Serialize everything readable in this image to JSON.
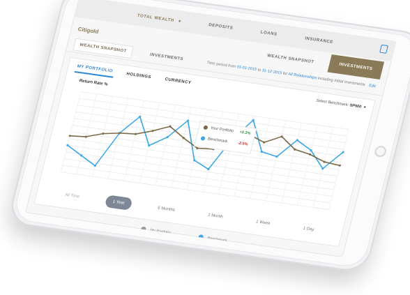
{
  "nav": {
    "total_wealth": "TOTAL WEALTH",
    "top_items": [
      "DEPOSITS",
      "LOANS",
      "INSURANCE"
    ]
  },
  "brand": "Citigold",
  "tabs": [
    "WEALTH SNAPSHOT",
    "INVESTMENTS"
  ],
  "subtabs": [
    "WEALTH SNAPSHOT",
    "INVESTMENTS"
  ],
  "period": {
    "prefix": "Time period from",
    "from": "01-01-2015",
    "to_word": "to",
    "to": "31-12-2015",
    "for_word": "for",
    "relationships": "All Relationships",
    "including": "including",
    "initial": "Initial Investments",
    "edit": "Edit"
  },
  "card": {
    "tabs": [
      "MY PORTFOLIO",
      "HOLDINGS",
      "CURRENCY"
    ],
    "select_benchmark_label": "Select Benchmark:",
    "benchmark_value": "SP500"
  },
  "chart": {
    "title": "Return Rate %",
    "legend": {
      "your_portfolio": "Your Portfolio",
      "your_portfolio_value": "+0.3%",
      "benchmark": "Benchmark",
      "benchmark_value": "-2.5%"
    }
  },
  "range_buttons": [
    "All Time",
    "1 Year",
    "6 Months",
    "1 Month",
    "1 Week",
    "1 Day"
  ],
  "bottom_legend": [
    "My Portfolio",
    "Benchmark"
  ],
  "colors": {
    "gold": "#8a7a58",
    "blue": "#2a86d8",
    "benchmark_line": "#3aa7e6",
    "portfolio_line": "#7b6a49",
    "positive": "#2b9a46",
    "negative": "#d12a2a"
  },
  "chart_data": {
    "type": "line",
    "title": "Return Rate %",
    "ylim": [
      -3,
      3
    ],
    "x": [
      1,
      2,
      3,
      4,
      5,
      6,
      7,
      8,
      9,
      10,
      11,
      12,
      13,
      14,
      15,
      16,
      17,
      18
    ],
    "series": [
      {
        "name": "Benchmark",
        "values": [
          -1.0,
          -1.6,
          -2.2,
          0.4,
          1.8,
          -0.2,
          0.6,
          2.0,
          -0.8,
          -1.3,
          1.1,
          2.7,
          0.5,
          0.3,
          1.7,
          1.1,
          -0.1,
          1.3
        ]
      },
      {
        "name": "Your Portfolio",
        "values": [
          -0.3,
          -0.2,
          0.2,
          0.4,
          0.5,
          0.9,
          1.4,
          0.7,
          0.1,
          0.2,
          0.9,
          1.6,
          1.2,
          1.8,
          1.0,
          0.8,
          0.4,
          0.3
        ]
      }
    ],
    "grid": true,
    "legend": "inside"
  }
}
